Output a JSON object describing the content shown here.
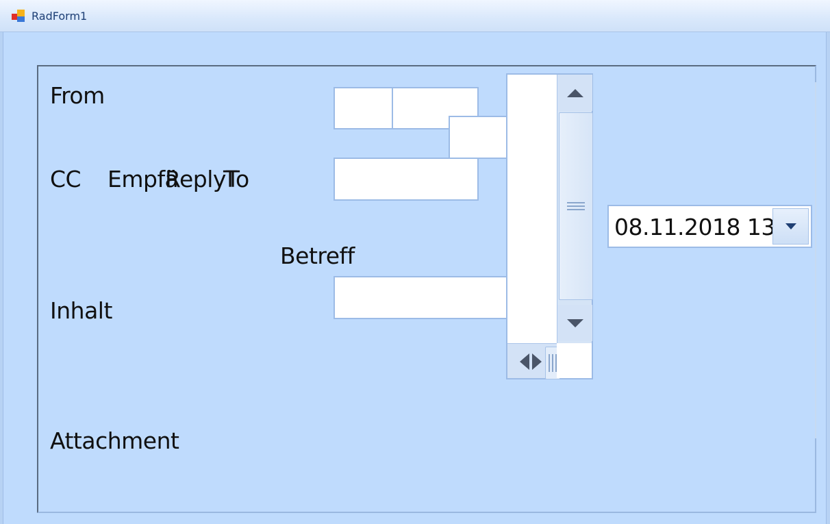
{
  "window": {
    "title": "RadForm1"
  },
  "labels": {
    "from": "From",
    "cc": "CC",
    "empfaenger": "Empfä",
    "reply_to": "ReplyTo",
    "to_overlap": "T",
    "betreff": "Betreff",
    "inhalt": "Inhalt",
    "attachment": "Attachment"
  },
  "datepicker": {
    "value": "08.11.2018 13:"
  },
  "icons": {
    "app": "app-icon",
    "scroll_up": "chevron-up-icon",
    "scroll_down": "chevron-down-icon",
    "scroll_left_right": "left-right-arrows-icon",
    "grip": "grip-icon",
    "dropdown": "dropdown-arrow-icon"
  },
  "colors": {
    "background": "#bfdbfd",
    "input_border": "#9cbbe6",
    "text": "#101010"
  }
}
